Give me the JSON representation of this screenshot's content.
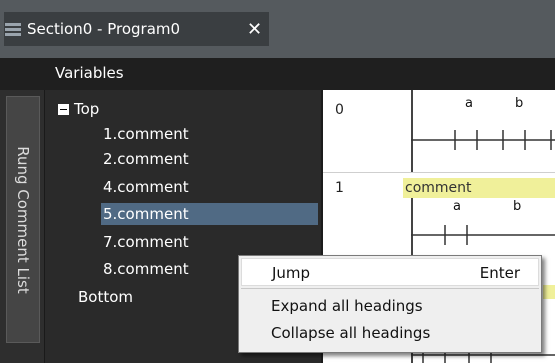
{
  "tab": {
    "title": "Section0 - Program0",
    "close": "✕"
  },
  "toolbar": {
    "label": "Variables"
  },
  "side_panel": {
    "label": "Rung Comment List"
  },
  "tree": {
    "items": [
      {
        "label": "Top"
      },
      {
        "label": "1.comment"
      },
      {
        "label": "2.comment"
      },
      {
        "label": "4.comment"
      },
      {
        "label": "5.comment"
      },
      {
        "label": "7.comment"
      },
      {
        "label": "8.comment"
      },
      {
        "label": "Bottom"
      }
    ]
  },
  "ladder": {
    "rung0": {
      "number": "0",
      "contact_a": "a",
      "contact_b": "b"
    },
    "rung1": {
      "number": "1",
      "comment": "comment",
      "contact_a": "a",
      "contact_b": "b"
    }
  },
  "context_menu": {
    "items": [
      {
        "label": "Jump",
        "shortcut": "Enter"
      },
      {
        "label": "Expand all headings"
      },
      {
        "label": "Collapse all headings"
      }
    ]
  }
}
